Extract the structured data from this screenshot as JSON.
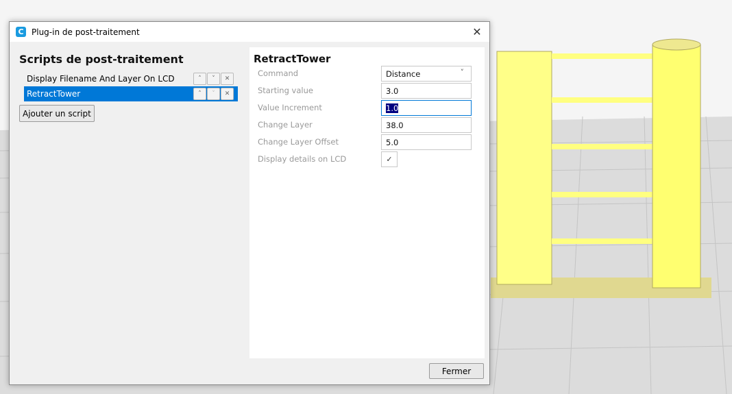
{
  "window": {
    "title": "Plug-in de post-traitement",
    "app_icon": "C"
  },
  "left": {
    "title": "Scripts de post-traitement",
    "scripts": [
      {
        "label": "Display Filename And Layer On LCD",
        "selected": false
      },
      {
        "label": "RetractTower",
        "selected": true
      }
    ],
    "add_label": "Ajouter un script",
    "up": "^",
    "down": "v",
    "remove": "×"
  },
  "settings": {
    "title": "RetractTower",
    "fields": [
      {
        "label": "Command",
        "value": "Distance"
      },
      {
        "label": "Starting value",
        "value": "3.0"
      },
      {
        "label": "Value Increment",
        "value": "1.0"
      },
      {
        "label": "Change Layer",
        "value": "38.0"
      },
      {
        "label": "Change Layer Offset",
        "value": "5.0"
      },
      {
        "label": "Display details on LCD",
        "value": "✓"
      }
    ]
  },
  "footer": {
    "close_label": "Fermer"
  },
  "colors": {
    "accent": "#0078d7",
    "model": "#ffff80"
  }
}
